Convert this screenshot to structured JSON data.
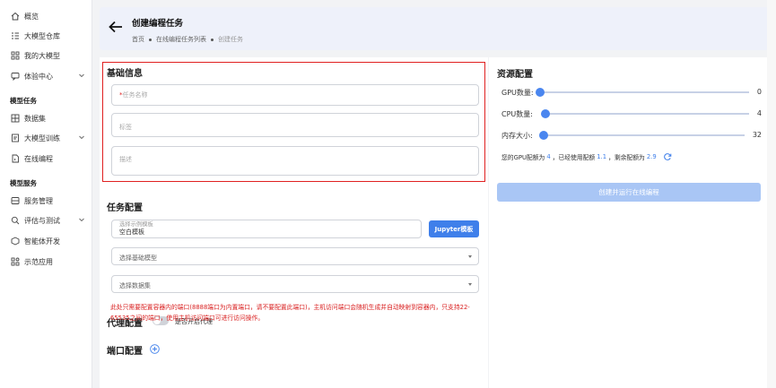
{
  "sidebar": {
    "items": [
      {
        "label": "概览",
        "icon": "home-icon"
      },
      {
        "label": "大模型仓库",
        "icon": "list-icon"
      },
      {
        "label": "我的大模型",
        "icon": "grid-icon"
      },
      {
        "label": "体验中心",
        "icon": "chat-icon"
      }
    ],
    "section_tasks": "模型任务",
    "task_items": [
      {
        "label": "数据集",
        "icon": "dataset-icon"
      },
      {
        "label": "大模型训练",
        "icon": "training-icon"
      },
      {
        "label": "在线编程",
        "icon": "code-icon"
      }
    ],
    "section_service": "模型服务",
    "service_items": [
      {
        "label": "服务管理",
        "icon": "server-icon"
      },
      {
        "label": "评估与测试",
        "icon": "eval-icon"
      },
      {
        "label": "智能体开发",
        "icon": "agent-icon"
      },
      {
        "label": "示范应用",
        "icon": "apps-icon"
      }
    ]
  },
  "header": {
    "title": "创建编程任务",
    "breadcrumb": [
      "首页",
      "在线编程任务列表",
      "创建任务"
    ]
  },
  "basic": {
    "title": "基础信息",
    "name_required": "*",
    "name_placeholder": "任务名称",
    "tag_placeholder": "标签",
    "desc_placeholder": "描述"
  },
  "task": {
    "title": "任务配置",
    "image_label": "选择示例模板",
    "image_value": "空白模板",
    "jupyter_button": "Jupyter模板",
    "base_model_placeholder": "选择基础模型",
    "dataset_placeholder": "选择数据集"
  },
  "proxy": {
    "title": "代理配置",
    "toggle_label": "是否开启代理"
  },
  "port": {
    "title": "端口配置",
    "notice": "此处只需要配置容器内的端口(8888端口为内置端口，请不要配置此端口)，主机访问端口会随机生成并自动映射到容器内，只支持22-65535之间的端口，使用主机访问端口可进行访问操作。"
  },
  "resources": {
    "title": "资源配置",
    "sliders": [
      {
        "label": "GPU数量:",
        "value": "0",
        "fraction": 0.0
      },
      {
        "label": "CPU数量:",
        "value": "4",
        "fraction": 0.0
      },
      {
        "label": "内存大小:",
        "value": "32",
        "fraction": 0.0
      }
    ],
    "quota_prefix": "您的GPU配额为",
    "quota_total": "4",
    "quota_used_prefix": "，已经使用配额",
    "quota_used": "1.1",
    "quota_left_prefix": "，剩余配额为",
    "quota_left": "2.9",
    "create_button": "创建并运行在线编程"
  },
  "colors": {
    "accent": "#3f7fea",
    "error": "#e02020",
    "disabled_button": "#a9c6f5"
  }
}
